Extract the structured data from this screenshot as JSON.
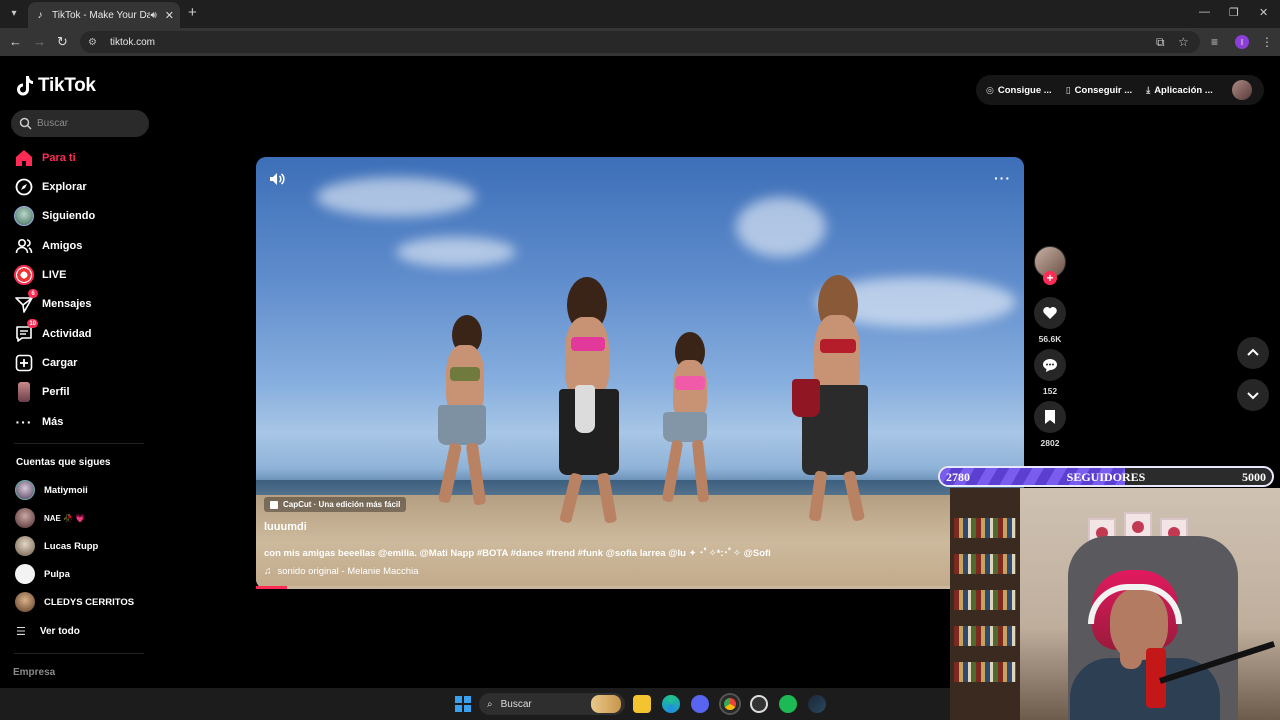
{
  "browser": {
    "tab_title": "TikTok - Make Your Day",
    "url": "tiktok.com",
    "profile_initial": "I"
  },
  "tiktok": {
    "logo_text": "TikTok",
    "search_placeholder": "Buscar",
    "nav": [
      {
        "label": "Para ti",
        "icon": "home-icon",
        "active": true
      },
      {
        "label": "Explorar",
        "icon": "compass-icon"
      },
      {
        "label": "Siguiendo",
        "icon": "following-avatar-icon"
      },
      {
        "label": "Amigos",
        "icon": "friends-icon"
      },
      {
        "label": "LIVE",
        "icon": "live-icon"
      },
      {
        "label": "Mensajes",
        "icon": "messages-icon",
        "badge": "6"
      },
      {
        "label": "Actividad",
        "icon": "activity-icon",
        "badge": "10"
      },
      {
        "label": "Cargar",
        "icon": "upload-icon"
      },
      {
        "label": "Perfil",
        "icon": "profile-avatar-icon"
      },
      {
        "label": "Más",
        "icon": "more-icon"
      }
    ],
    "following_title": "Cuentas que sigues",
    "following": [
      {
        "name": "Matiymoii"
      },
      {
        "name": "NAE 🥀 💗"
      },
      {
        "name": "Lucas Rupp"
      },
      {
        "name": "Pulpa"
      },
      {
        "name": "CLEDYS CERRITOS"
      }
    ],
    "see_all": "Ver todo",
    "company": "Empresa",
    "top_actions": [
      {
        "label": "Consigue ...",
        "icon": "coin-icon"
      },
      {
        "label": "Conseguir ...",
        "icon": "phone-icon"
      },
      {
        "label": "Aplicación ...",
        "icon": "download-icon"
      }
    ],
    "video": {
      "capcut_label": "CapCut · Una edición más fácil",
      "author": "luuumdi",
      "description": "con mis amigas beeellas @emilia. @Mati Napp #BOTA #dance #trend #funk @sofia larrea @lu ✦ ･ﾟ✧*:･ﾟ✧ @Sofi",
      "music": "sonido original - Melanie Macchia",
      "progress": 0.04
    },
    "stats": {
      "likes": "56.6K",
      "comments": "152",
      "saves": "2802"
    }
  },
  "overlay": {
    "goal_current": "2780",
    "goal_label": "SEGUIDORES",
    "goal_target": "5000",
    "goal_fraction": 0.556
  },
  "taskbar": {
    "search_label": "Buscar"
  },
  "colors": {
    "accent": "#fe2c55",
    "goal_fill": "#7a5cf0"
  }
}
